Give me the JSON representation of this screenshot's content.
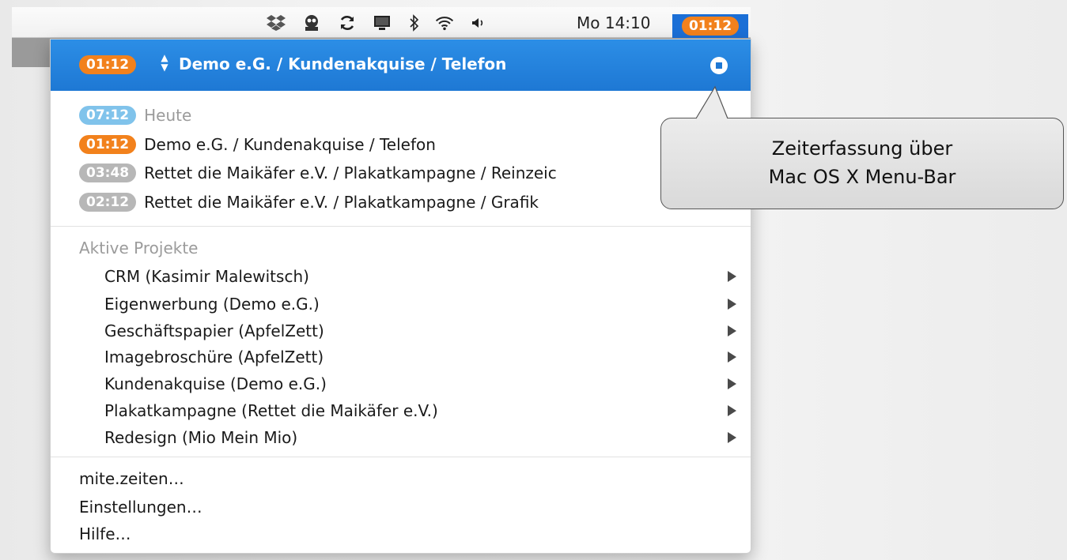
{
  "menubar": {
    "tray_icons": [
      "dropbox-icon",
      "ghost-icon",
      "sync-icon",
      "display-icon",
      "bluetooth-icon",
      "wifi-icon",
      "volume-icon"
    ],
    "clock": "Mo 14:10",
    "timer": "01:12"
  },
  "menu": {
    "header": {
      "timer": "01:12",
      "title": "Demo e.G. / Kundenakquise / Telefon"
    },
    "today": {
      "total": "07:12",
      "label": "Heute",
      "entries": [
        {
          "time": "01:12",
          "label": "Demo e.G. / Kundenakquise / Telefon",
          "active": true
        },
        {
          "time": "03:48",
          "label": "Rettet die Maikäfer e.V. / Plakatkampagne / Reinzeic",
          "active": false
        },
        {
          "time": "02:12",
          "label": "Rettet die Maikäfer e.V. / Plakatkampagne / Grafik",
          "active": false
        }
      ]
    },
    "projects": {
      "heading": "Aktive Projekte",
      "items": [
        "CRM (Kasimir Malewitsch)",
        "Eigenwerbung (Demo e.G.)",
        "Geschäftspapier (ApfelZett)",
        "Imagebroschüre (ApfelZett)",
        "Kundenakquise (Demo e.G.)",
        "Plakatkampagne (Rettet die Maikäfer e.V.)",
        "Redesign (Mio Mein Mio)"
      ]
    },
    "footer": [
      "mite.zeiten…",
      "Einstellungen…",
      "Hilfe…"
    ]
  },
  "callout": {
    "line1": "Zeiterfassung über",
    "line2": "Mac OS X Menu-Bar"
  },
  "colors": {
    "accent_blue": "#1e78d4",
    "active_orange": "#f2811c",
    "today_blue": "#80c3eb",
    "inactive_gray": "#b7b7b7"
  }
}
